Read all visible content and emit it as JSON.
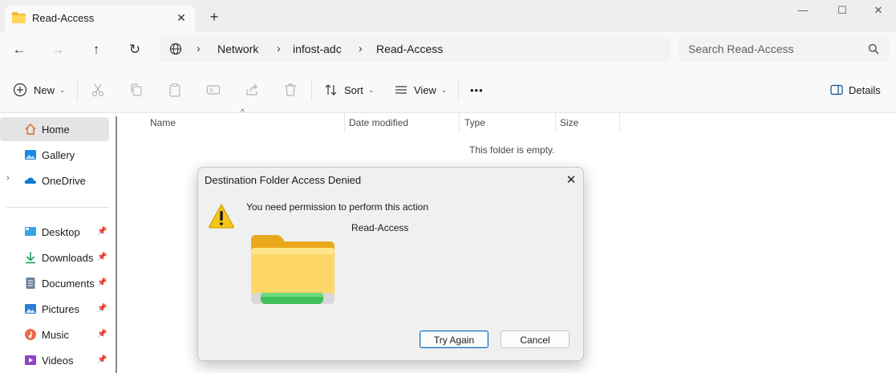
{
  "window": {
    "tab_title": "Read-Access",
    "tab_close_glyph": "✕",
    "new_tab_glyph": "+",
    "minimize_glyph": "—",
    "maximize_glyph": "☐",
    "close_glyph": "✕"
  },
  "nav": {
    "back_glyph": "←",
    "forward_glyph": "→",
    "up_glyph": "↑",
    "refresh_glyph": "↻",
    "breadcrumbs": [
      "Network",
      "infost-adc",
      "Read-Access"
    ],
    "separator": "›",
    "search_placeholder": "Search Read-Access"
  },
  "toolbar": {
    "new_label": "New",
    "sort_label": "Sort",
    "view_label": "View",
    "more_label": "•••",
    "details_label": "Details",
    "dropdown_glyph": "⌄"
  },
  "sidebar": {
    "expander_glyph": "›",
    "pin_glyph": "📌",
    "items": [
      {
        "label": "Home",
        "icon": "home-icon"
      },
      {
        "label": "Gallery",
        "icon": "gallery-icon"
      },
      {
        "label": "OneDrive",
        "icon": "onedrive-icon"
      },
      {
        "label": "Desktop",
        "icon": "desktop-icon"
      },
      {
        "label": "Downloads",
        "icon": "downloads-icon"
      },
      {
        "label": "Documents",
        "icon": "documents-icon"
      },
      {
        "label": "Pictures",
        "icon": "pictures-icon"
      },
      {
        "label": "Music",
        "icon": "music-icon"
      },
      {
        "label": "Videos",
        "icon": "videos-icon"
      }
    ]
  },
  "content": {
    "columns": [
      "Name",
      "Date modified",
      "Type",
      "Size"
    ],
    "sort_glyph": "^",
    "empty_message": "This folder is empty."
  },
  "dialog": {
    "title": "Destination Folder Access Denied",
    "close_glyph": "✕",
    "message": "You need permission to perform this action",
    "folder_name": "Read-Access",
    "try_again_label": "Try Again",
    "cancel_label": "Cancel"
  },
  "colors": {
    "accent": "#0067c0",
    "folder_yellow": "#f8c53a",
    "warning_yellow": "#f5c518",
    "sync_green": "#3fbf5a"
  }
}
